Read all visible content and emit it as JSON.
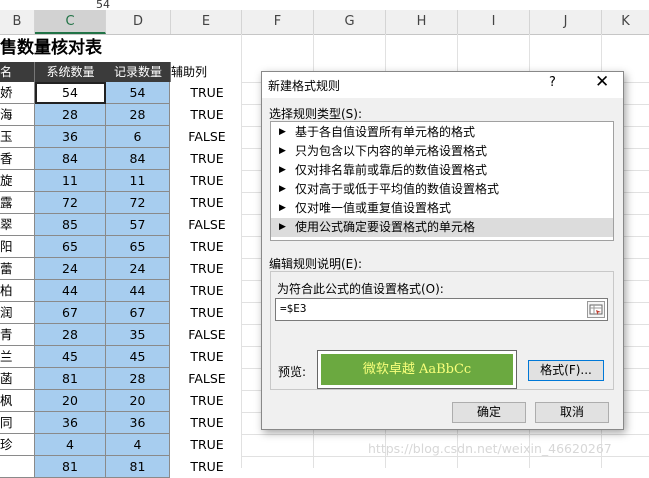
{
  "formula_bar_value": "54",
  "columns": [
    "B",
    "C",
    "D",
    "E",
    "F",
    "G",
    "H",
    "I",
    "J",
    "K"
  ],
  "sheet": {
    "title": "售数量核对表",
    "headers": [
      "名",
      "系统数量",
      "记录数量",
      "辅助列"
    ],
    "rows": [
      {
        "name": "娇",
        "c": "54",
        "d": "54",
        "e": "TRUE"
      },
      {
        "name": "海",
        "c": "28",
        "d": "28",
        "e": "TRUE"
      },
      {
        "name": "玉",
        "c": "36",
        "d": "6",
        "e": "FALSE"
      },
      {
        "name": "香",
        "c": "84",
        "d": "84",
        "e": "TRUE"
      },
      {
        "name": "旋",
        "c": "11",
        "d": "11",
        "e": "TRUE"
      },
      {
        "name": "露",
        "c": "72",
        "d": "72",
        "e": "TRUE"
      },
      {
        "name": "翠",
        "c": "85",
        "d": "57",
        "e": "FALSE"
      },
      {
        "name": "阳",
        "c": "65",
        "d": "65",
        "e": "TRUE"
      },
      {
        "name": "蕾",
        "c": "24",
        "d": "24",
        "e": "TRUE"
      },
      {
        "name": "柏",
        "c": "44",
        "d": "44",
        "e": "TRUE"
      },
      {
        "name": "润",
        "c": "67",
        "d": "67",
        "e": "TRUE"
      },
      {
        "name": "青",
        "c": "28",
        "d": "35",
        "e": "FALSE"
      },
      {
        "name": "兰",
        "c": "45",
        "d": "45",
        "e": "TRUE"
      },
      {
        "name": "菡",
        "c": "81",
        "d": "28",
        "e": "FALSE"
      },
      {
        "name": "枫",
        "c": "20",
        "d": "20",
        "e": "TRUE"
      },
      {
        "name": "同",
        "c": "36",
        "d": "36",
        "e": "TRUE"
      },
      {
        "name": "珍",
        "c": "4",
        "d": "4",
        "e": "TRUE"
      },
      {
        "name": "",
        "c": "81",
        "d": "81",
        "e": "TRUE"
      }
    ]
  },
  "dialog": {
    "title": "新建格式规则",
    "help": "?",
    "close": "✕",
    "select_type_label": "选择规则类型(S):",
    "rule_types": [
      "基于各自值设置所有单元格的格式",
      "只为包含以下内容的单元格设置格式",
      "仅对排名靠前或靠后的数值设置格式",
      "仅对高于或低于平均值的数值设置格式",
      "仅对唯一值或重复值设置格式",
      "使用公式确定要设置格式的单元格"
    ],
    "selected_rule_index": 5,
    "edit_label": "编辑规则说明(E):",
    "formula_label": "为符合此公式的值设置格式(O):",
    "formula_value": "=$E3",
    "preview_label": "预览:",
    "preview_text": "微软卓越  AaBbCc",
    "format_button": "格式(F)...",
    "ok_button": "确定",
    "cancel_button": "取消"
  },
  "watermark": "https://blog.csdn.net/weixin_46620267",
  "colors": {
    "accent_green": "#217346",
    "cell_blue": "#a7cdef",
    "header_dark": "#3b3b3b",
    "preview_green": "#6ba940"
  }
}
